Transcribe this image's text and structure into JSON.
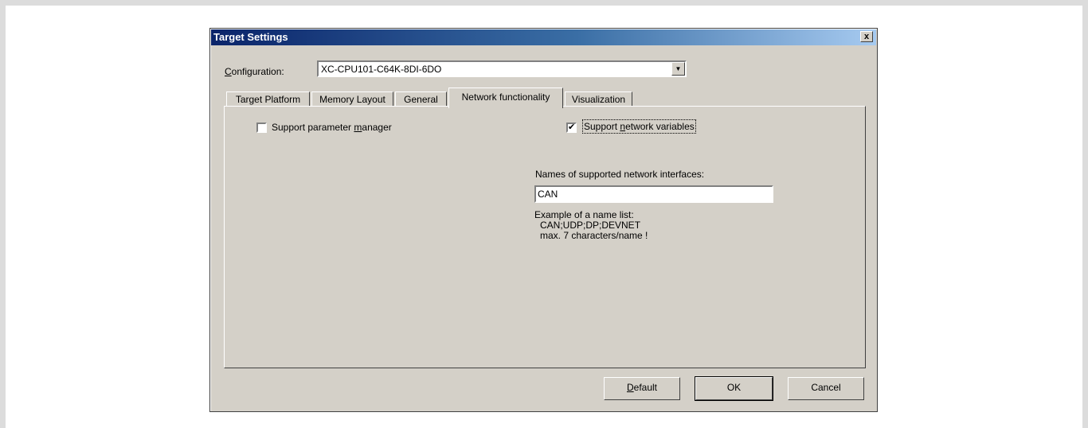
{
  "dialog": {
    "title": "Target Settings",
    "close_glyph": "x"
  },
  "configuration": {
    "label_accel": "C",
    "label_rest": "onfiguration:",
    "value": "XC-CPU101-C64K-8DI-6DO",
    "arrow_glyph": "▼"
  },
  "tabs": [
    {
      "label": "Target Platform",
      "active": false
    },
    {
      "label": "Memory Layout",
      "active": false
    },
    {
      "label": "General",
      "active": false
    },
    {
      "label": "Network functionality",
      "active": true
    },
    {
      "label": "Visualization",
      "active": false
    }
  ],
  "panel": {
    "support_param": {
      "checked": false,
      "label_pre": "Support parameter ",
      "label_accel": "m",
      "label_post": "anager"
    },
    "support_netvars": {
      "checked": true,
      "check_glyph": "✔",
      "label_pre": "Support ",
      "label_accel": "n",
      "label_post": "etwork variables"
    },
    "names_label": "Names of supported network interfaces:",
    "names_value": "CAN",
    "example_line1": "Example of a name list:",
    "example_line2": "CAN;UDP;DP;DEVNET",
    "example_line3": "max. 7 characters/name !"
  },
  "buttons": {
    "default_accel": "D",
    "default_rest": "efault",
    "ok": "OK",
    "cancel": "Cancel"
  }
}
